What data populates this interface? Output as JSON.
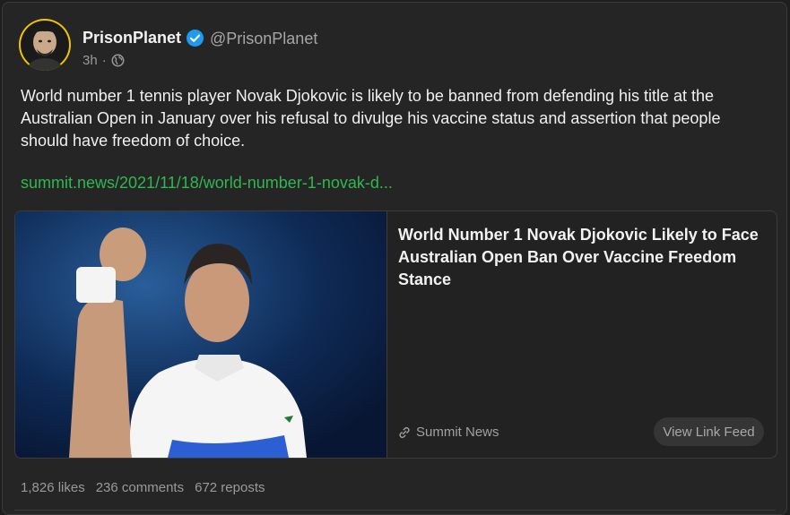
{
  "post": {
    "author_name": "PrisonPlanet",
    "handle": "@PrisonPlanet",
    "time": "3h",
    "separator": "·",
    "text": "World number 1 tennis player Novak Djokovic is likely to be banned from defending his title at the Australian Open in January over his refusal to divulge his vaccine status and assertion that people should have freedom of choice.",
    "link_text": "summit.news/2021/11/18/world-number-1-novak-d...",
    "card": {
      "title": "World Number 1 Novak Djokovic Likely to Face Australian Open Ban Over Vaccine Freedom Stance",
      "source": "Summit News",
      "button_label": "View Link Feed"
    },
    "stats": {
      "likes": "1,826 likes",
      "comments": "236 comments",
      "reposts": "672 reposts"
    }
  },
  "colors": {
    "background": "#1e1e1e",
    "link": "#2fb84e",
    "verified": "#1d9bf0",
    "avatar_ring": "#f2c400"
  },
  "icons": [
    "verified-badge-icon",
    "globe-icon",
    "link-icon"
  ]
}
